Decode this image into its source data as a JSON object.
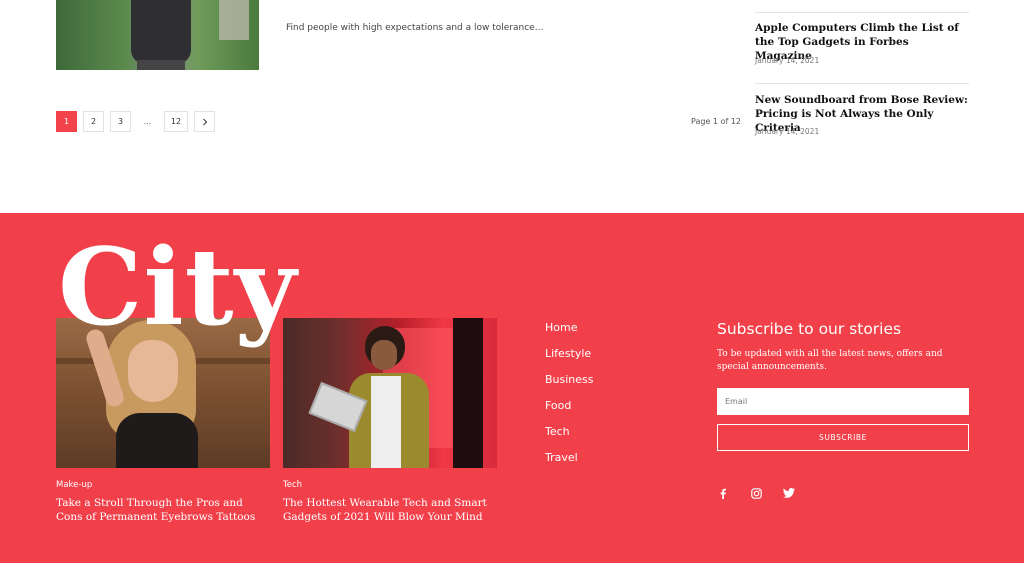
{
  "main": {
    "excerpt": "Find people with high expectations and a low tolerance...",
    "pagination": {
      "pages": [
        "1",
        "2",
        "3"
      ],
      "ellipsis": "...",
      "last_page": "12",
      "next_icon": "chevron-right-icon",
      "info": "Page 1 of 12"
    }
  },
  "sidebar": {
    "items": [
      {
        "title": "Apple Computers Climb the List of the Top Gadgets in Forbes Magazine",
        "date": "January 14, 2021"
      },
      {
        "title": "New Soundboard from Bose Review: Pricing is Not Always the Only Criteria",
        "date": "January 14, 2021"
      }
    ]
  },
  "footer": {
    "logo": "City",
    "posts": [
      {
        "category": "Make-up",
        "title": "Take a Stroll Through the Pros and Cons of Permanent Eyebrows Tattoos"
      },
      {
        "category": "Tech",
        "title": "The Hottest Wearable Tech and Smart Gadgets of 2021 Will Blow Your Mind"
      }
    ],
    "nav": [
      "Home",
      "Lifestyle",
      "Business",
      "Food",
      "Tech",
      "Travel"
    ],
    "subscribe": {
      "title": "Subscribe to our stories",
      "text": "To be updated with all the latest news, offers and special announcements.",
      "email_placeholder": "Email",
      "button": "SUBSCRIBE"
    },
    "social": [
      "facebook-icon",
      "instagram-icon",
      "twitter-icon"
    ]
  },
  "colors": {
    "accent": "#f2404a",
    "text": "#111111",
    "muted": "#777777"
  }
}
